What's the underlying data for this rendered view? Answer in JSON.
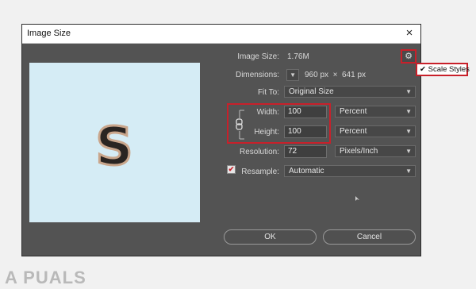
{
  "dialog": {
    "title": "Image Size",
    "close_symbol": "×"
  },
  "preview": {
    "letter": "S"
  },
  "fields": {
    "image_size_label": "Image Size:",
    "image_size_value": "1.76M",
    "dimensions_label": "Dimensions:",
    "dimensions_width": "960",
    "dimensions_unit_1": "px",
    "dimensions_sep": "×",
    "dimensions_height": "641",
    "dimensions_unit_2": "px",
    "fit_to_label": "Fit To:",
    "fit_to_value": "Original Size",
    "width_label": "Width:",
    "width_value": "100",
    "width_unit": "Percent",
    "height_label": "Height:",
    "height_value": "100",
    "height_unit": "Percent",
    "resolution_label": "Resolution:",
    "resolution_value": "72",
    "resolution_unit": "Pixels/Inch",
    "resample_label": "Resample:",
    "resample_value": "Automatic",
    "resample_checked": true
  },
  "settings_menu": {
    "check": "✔",
    "scale_styles": "Scale Styles"
  },
  "buttons": {
    "ok": "OK",
    "cancel": "Cancel"
  },
  "watermark": "A PUALS",
  "colors": {
    "dialog_bg": "#535353",
    "highlight": "#c8202a",
    "preview_bg": "#d5ecf5"
  },
  "icons": [
    "close-icon",
    "gear-icon",
    "chevron-down-icon",
    "link-chain-icon",
    "checkmark-icon"
  ]
}
